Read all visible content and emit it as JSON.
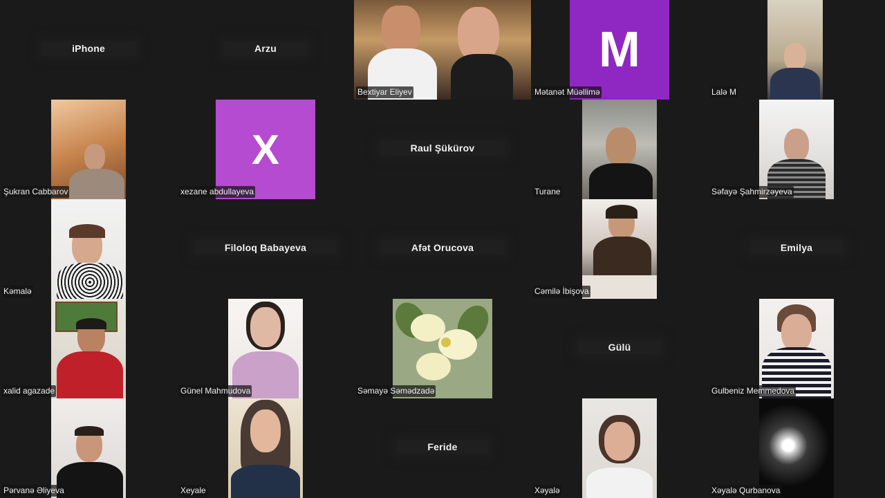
{
  "participants": [
    {
      "name": "iPhone"
    },
    {
      "name": "Arzu"
    },
    {
      "name": "Bextiyar Eliyev"
    },
    {
      "name": "Mətanət Müəllimə",
      "initial": "M"
    },
    {
      "name": "Lalə M"
    },
    {
      "name": "Şukran Cabbarov"
    },
    {
      "name": "xezane abdullayeva",
      "initial": "X"
    },
    {
      "name": "Raul Şükürov"
    },
    {
      "name": "Turane"
    },
    {
      "name": "Səfayə Şahmirzəyeva"
    },
    {
      "name": "Kəmalə"
    },
    {
      "name": "Filoloq Babayeva"
    },
    {
      "name": "Afət Orucova"
    },
    {
      "name": "Cəmilə İbişova"
    },
    {
      "name": "Emilya"
    },
    {
      "name": "xalid agazade"
    },
    {
      "name": "Günel Mahmudova"
    },
    {
      "name": "Səmayə Səmədzadə"
    },
    {
      "name": "Gülü"
    },
    {
      "name": "Gulbeniz Memmedova"
    },
    {
      "name": "Pərvanə Əliyeva"
    },
    {
      "name": "Xeyale"
    },
    {
      "name": "Feride"
    },
    {
      "name": "Xəyalə"
    },
    {
      "name": "Xəyalə Qurbanova"
    }
  ],
  "colors": {
    "background": "#1a1a1a",
    "avatar_purple": "#8f27c2",
    "avatar_violet": "#b44bd0"
  }
}
